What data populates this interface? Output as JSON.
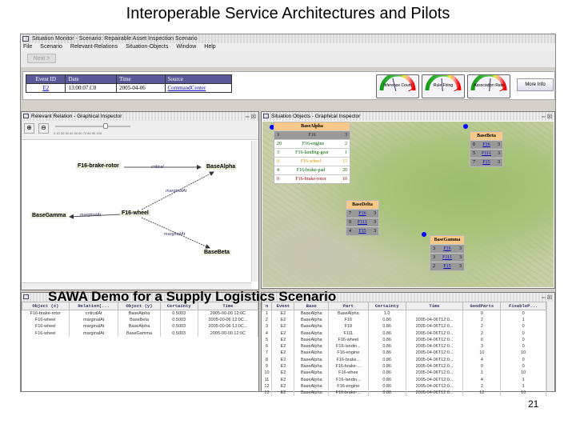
{
  "slide": {
    "title": "Interoperable Service Architectures and Pilots",
    "overlay": "SAWA Demo for a Supply Logistics Scenario",
    "page": "21"
  },
  "window": {
    "title": "Situation Monitor - Scenario: Repairable Asset Inspection Scenario"
  },
  "menu": [
    "File",
    "Scenario",
    "Relevant-Relations",
    "Situation-Objects",
    "Window",
    "Help"
  ],
  "toolbar": {
    "next": "Next >"
  },
  "events": {
    "headers": [
      "Event ID",
      "Date",
      "Time",
      "Source"
    ],
    "row": [
      "E2",
      "13:00:07.C0",
      "2005-04-06",
      "CommandCenter"
    ]
  },
  "gauges": [
    "Inference Count",
    "Rule Firing",
    "Association Rate"
  ],
  "more_info": "More Info",
  "relation_panel": {
    "title": "Relevant Relation - Graphical Inspector",
    "zoom_ticks": "0 10 20 30 40 50 60 70 80 90 100",
    "nodes": {
      "a": "F16-brake-rotor",
      "b": "BaseAlpha",
      "c": "F16-wheel",
      "d": "BaseGamma",
      "e": "BaseBeta"
    },
    "edges": {
      "ab": "critical",
      "cb": "marginalAt",
      "cd": "marginalAt",
      "ce": "marginalAt"
    }
  },
  "objects_panel": {
    "title": "Situation Objects - Graphical Inspector",
    "alpha": {
      "name": "BaseAlpha",
      "rows": [
        [
          "3",
          "F16",
          "3"
        ],
        [
          "20",
          "F16-engine",
          "2"
        ],
        [
          "3",
          "F16-landing-gear",
          "1"
        ],
        [
          "0",
          "F16-wheel",
          "15"
        ],
        [
          "4",
          "F16-brake-pad",
          "20"
        ],
        [
          "0",
          "F16-brake-rotor",
          "10"
        ]
      ]
    },
    "delta": {
      "name": "BaseDelta",
      "rows": [
        [
          "7",
          "F16",
          "3"
        ],
        [
          "0",
          "F111",
          "3"
        ],
        [
          "4",
          "F15",
          "3"
        ]
      ]
    },
    "beta": {
      "name": "BaseBeta",
      "rows": [
        [
          "0",
          "F16",
          "3"
        ],
        [
          "5",
          "F111",
          "3"
        ],
        [
          "7",
          "F15",
          "3"
        ]
      ]
    },
    "gamma": {
      "name": "BaseGamma",
      "rows": [
        [
          "3",
          "F16",
          "3"
        ],
        [
          "3",
          "F111",
          "3"
        ],
        [
          "2",
          "F15",
          "3"
        ]
      ]
    }
  },
  "rel_table": {
    "headers": [
      "Object (x)",
      "Relation(...",
      "Object (y)",
      "Certainty",
      "Time"
    ],
    "rows": [
      [
        "F16-brake-rotor",
        "criticalAt",
        "BaseAlpha",
        "0.5003",
        "2005-00-00 12:0C"
      ],
      [
        "F16-wheel",
        "marginalAt",
        "BaseBeta",
        "0.5003",
        "2005-00-06 12:0C..."
      ],
      [
        "F16-wheel",
        "marginalAt",
        "BaseAlpha",
        "0.5003",
        "2005-00-06 12:0C..."
      ],
      [
        "F16-wheel",
        "marginalAt",
        "BaseGamma",
        "0.5003",
        "2005-00-00 12:0C"
      ]
    ]
  },
  "obj_table": {
    "headers": [
      "n",
      "Event",
      "Base",
      "Part",
      "Certainty",
      "Time",
      "GoodParts",
      "FixableP..."
    ],
    "rows": [
      [
        "1",
        "E2",
        "BaseAlpha",
        "BaseAlpha",
        "1.0",
        "",
        "0",
        "0"
      ],
      [
        "2",
        "E2",
        "BaseAlpha",
        "F16",
        "0.86",
        "2005-04-06T12:0...",
        "2",
        "1"
      ],
      [
        "3",
        "E2",
        "BaseAlpha",
        "F18",
        "0.86",
        "2005-04-06T12:0...",
        "2",
        "0"
      ],
      [
        "4",
        "E2",
        "BaseAlpha",
        "F111",
        "0.86",
        "2005-04-06T12:0...",
        "2",
        "0"
      ],
      [
        "5",
        "E2",
        "BaseAlpha",
        "F16-wheel",
        "0.86",
        "2005-04-06T12:0...",
        "0",
        "0"
      ],
      [
        "6",
        "E2",
        "BaseAlpha",
        "F16-landin...",
        "0.86",
        "2005-04-06T12:0...",
        "3",
        "0"
      ],
      [
        "7",
        "E2",
        "BaseAlpha",
        "F16-engine",
        "0.86",
        "2005-04-06T12:0...",
        "10",
        "10"
      ],
      [
        "8",
        "E2",
        "BaseAlpha",
        "F16-brake...",
        "0.86",
        "2005-04-06T12:0...",
        "4",
        "0"
      ],
      [
        "9",
        "E2",
        "BaseAlpha",
        "F16-brake-...",
        "0.86",
        "2005-04-06T12:0...",
        "0",
        "0"
      ],
      [
        "10",
        "E2",
        "BaseAlpha",
        "F16-whee",
        "0.86",
        "2005-04-06T12:0...",
        "1",
        "10"
      ],
      [
        "11",
        "E2",
        "BaseAlpha",
        "F16-landin...",
        "0.86",
        "2005-04-06T12:0...",
        "4",
        "1"
      ],
      [
        "12",
        "E2",
        "BaseAlpha",
        "F16-engine",
        "0.86",
        "2005-04-06T12:0...",
        "2",
        "1"
      ],
      [
        "13",
        "E2",
        "BaseAlpha",
        "F16-brake-...",
        "0.86",
        "2005-04-06T12:0...",
        "12",
        "10"
      ]
    ]
  }
}
